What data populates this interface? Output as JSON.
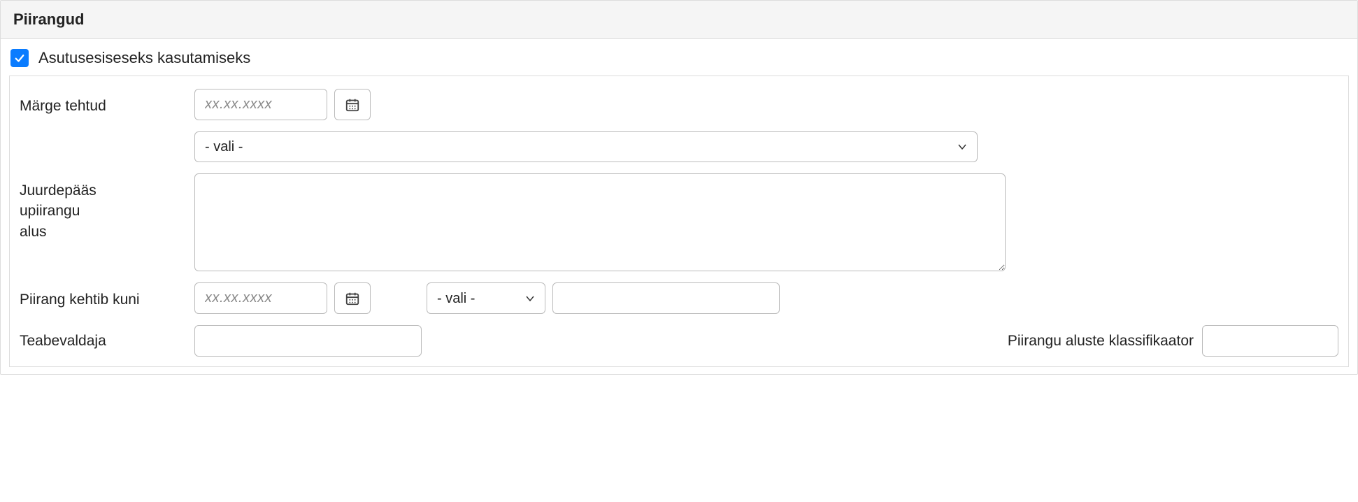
{
  "panel": {
    "title": "Piirangud"
  },
  "checkbox": {
    "label": "Asutusesiseseks kasutamiseks",
    "checked": true
  },
  "fields": {
    "marked": {
      "label": "Märge tehtud",
      "date_placeholder": "xx.xx.xxxx",
      "date_value": "",
      "select_value": "- vali -"
    },
    "basis": {
      "label": "Juurdepääs\nupiirangu\nalus",
      "text_value": ""
    },
    "valid_until": {
      "label": "Piirang kehtib kuni",
      "date_placeholder": "xx.xx.xxxx",
      "date_value": "",
      "select_value": "- vali -",
      "extra_value": ""
    },
    "holder": {
      "label": "Teabevaldaja",
      "value": ""
    },
    "classifier": {
      "label": "Piirangu aluste klassifikaator",
      "value": ""
    }
  }
}
